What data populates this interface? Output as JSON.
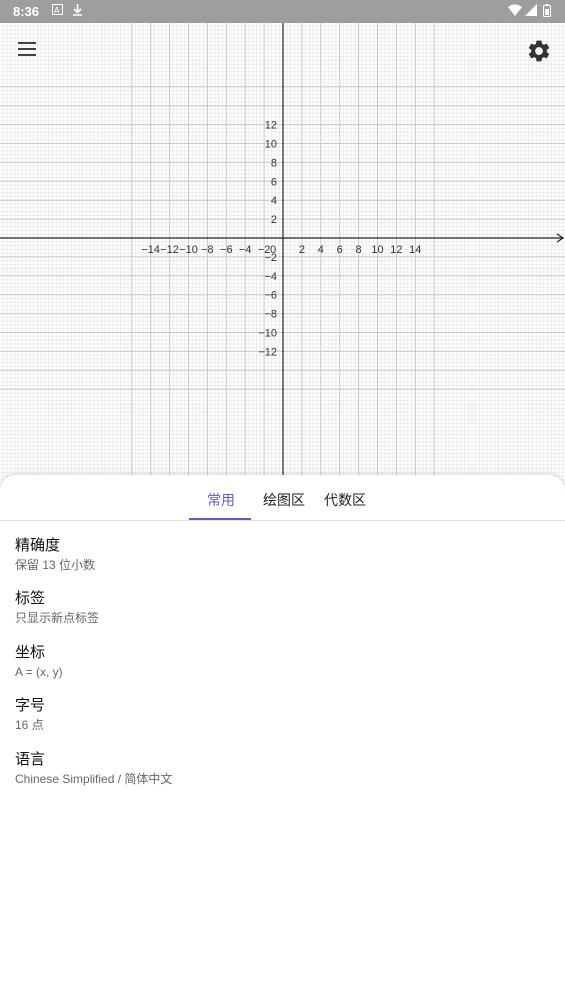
{
  "status_bar": {
    "time": "8:36",
    "left_icons": [
      "text-notification-icon",
      "download-icon"
    ],
    "right_icons": [
      "wifi-icon",
      "signal-icon",
      "battery-icon"
    ]
  },
  "graph": {
    "x_ticks": [
      "−14",
      "−12",
      "−10",
      "−8",
      "−6",
      "−4",
      "−2",
      "0",
      "2",
      "4",
      "6",
      "8",
      "10",
      "12",
      "14"
    ],
    "y_ticks": [
      "12",
      "10",
      "8",
      "6",
      "4",
      "2",
      "−2",
      "−4",
      "−6",
      "−8",
      "−10",
      "−12"
    ],
    "x_range": [
      -14,
      14
    ],
    "y_range": [
      -12,
      12
    ],
    "grid": true
  },
  "toolbar": {
    "menu_icon": "hamburger-menu-icon",
    "settings_icon": "gear-icon"
  },
  "tabs": [
    {
      "label": "常用",
      "active": true
    },
    {
      "label": "绘图区",
      "active": false
    },
    {
      "label": "代数区",
      "active": false
    }
  ],
  "settings": [
    {
      "title": "精确度",
      "value": "保留 13 位小数"
    },
    {
      "title": "标签",
      "value": "只显示新点标签"
    },
    {
      "title": "坐标",
      "value": "A = (x, y)"
    },
    {
      "title": "字号",
      "value": "16 点"
    },
    {
      "title": "语言",
      "value": "Chinese Simplified / 简体中文"
    }
  ],
  "colors": {
    "accent": "#6557d2",
    "status_bar": "#9e9e9e",
    "grid_major": "#c8c8c8",
    "grid_minor": "#ececec"
  }
}
